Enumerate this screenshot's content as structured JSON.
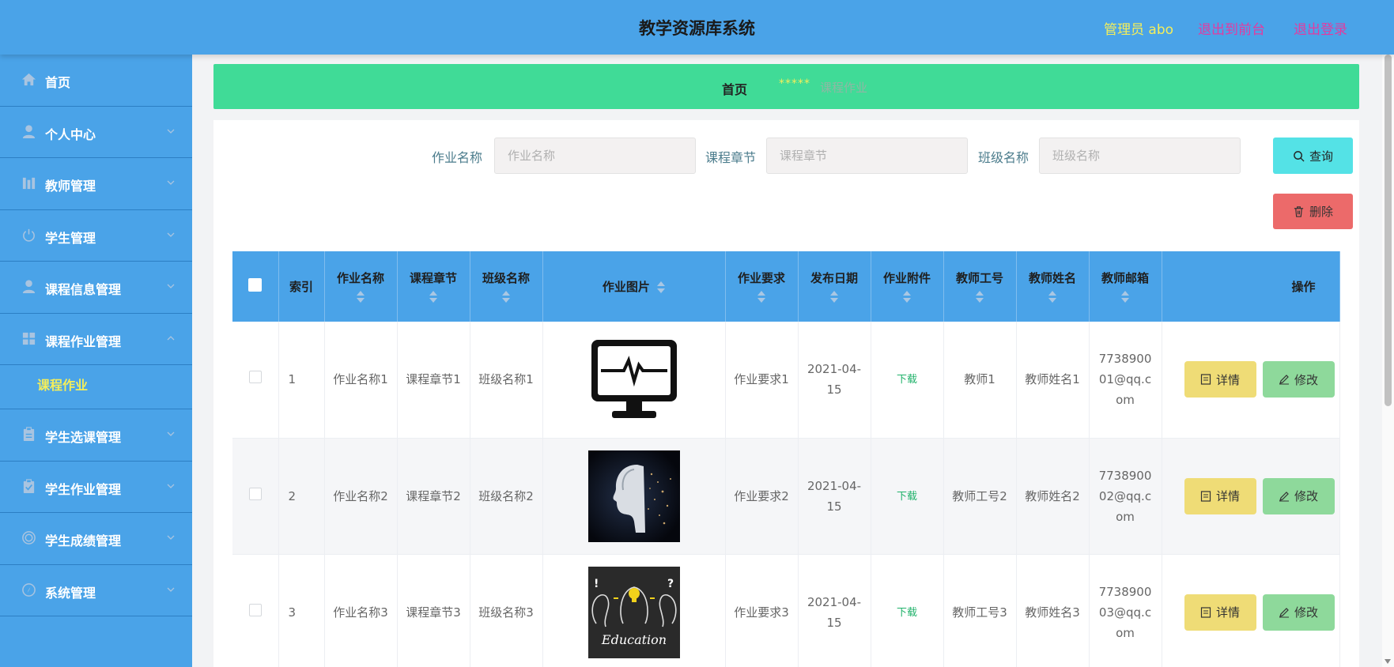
{
  "header": {
    "title": "教学资源库系统",
    "user_label": "管理员 abo",
    "back_to_front": "退出到前台",
    "logout": "退出登录"
  },
  "sidebar": {
    "items": [
      {
        "label": "首页",
        "icon": "home-icon"
      },
      {
        "label": "个人中心",
        "icon": "user-icon"
      },
      {
        "label": "教师管理",
        "icon": "chart-icon"
      },
      {
        "label": "学生管理",
        "icon": "power-icon"
      },
      {
        "label": "课程信息管理",
        "icon": "user-icon"
      },
      {
        "label": "课程作业管理",
        "icon": "grid-icon"
      },
      {
        "label": "学生选课管理",
        "icon": "clipboard-icon"
      },
      {
        "label": "学生作业管理",
        "icon": "clipboard-check-icon"
      },
      {
        "label": "学生成绩管理",
        "icon": "target-icon"
      },
      {
        "label": "系统管理",
        "icon": "compass-icon"
      }
    ],
    "submenu": {
      "label": "课程作业"
    }
  },
  "breadcrumb": {
    "home": "首页",
    "separator": "*****",
    "current": "课程作业"
  },
  "search": {
    "homework_name_label": "作业名称",
    "homework_name_placeholder": "作业名称",
    "chapter_label": "课程章节",
    "chapter_placeholder": "课程章节",
    "class_label": "班级名称",
    "class_placeholder": "班级名称",
    "query_button": "查询",
    "delete_button": "删除"
  },
  "table": {
    "headers": {
      "index": "索引",
      "homework_name": "作业名称",
      "chapter": "课程章节",
      "class_name": "班级名称",
      "image": "作业图片",
      "requirement": "作业要求",
      "publish_date": "发布日期",
      "attachment": "作业附件",
      "teacher_id": "教师工号",
      "teacher_name": "教师姓名",
      "teacher_email": "教师邮箱",
      "actions": "操作"
    },
    "rows": [
      {
        "index": "1",
        "homework_name": "作业名称1",
        "chapter": "课程章节1",
        "class_name": "班级名称1",
        "image": "monitor-heartbeat",
        "requirement": "作业要求1",
        "publish_date": "2021-04-15",
        "attachment": "下载",
        "teacher_id": "教师1",
        "teacher_name": "教师姓名1",
        "teacher_email": "773890001@qq.com"
      },
      {
        "index": "2",
        "homework_name": "作业名称2",
        "chapter": "课程章节2",
        "class_name": "班级名称2",
        "image": "ai-face",
        "requirement": "作业要求2",
        "publish_date": "2021-04-15",
        "attachment": "下载",
        "teacher_id": "教师工号2",
        "teacher_name": "教师姓名2",
        "teacher_email": "773890002@qq.com"
      },
      {
        "index": "3",
        "homework_name": "作业名称3",
        "chapter": "课程章节3",
        "class_name": "班级名称3",
        "image": "education-chalkboard",
        "requirement": "作业要求3",
        "publish_date": "2021-04-15",
        "attachment": "下载",
        "teacher_id": "教师工号3",
        "teacher_name": "教师姓名3",
        "teacher_email": "773890003@qq.com"
      }
    ],
    "detail_button": "详情",
    "edit_button": "修改",
    "education_text": "Education"
  },
  "colors": {
    "header_bg": "#4aa3e8",
    "breadcrumb_bg": "#40db97",
    "query_btn": "#54e2e6",
    "delete_btn": "#ec6a6a",
    "detail_btn": "#efdc76",
    "edit_btn": "#8ed99b"
  }
}
